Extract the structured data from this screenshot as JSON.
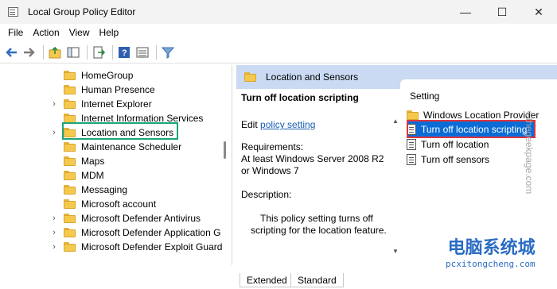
{
  "window": {
    "title": "Local Group Policy Editor",
    "min_glyph": "—",
    "max_glyph": "☐",
    "close_glyph": "✕"
  },
  "menu": [
    "File",
    "Action",
    "View",
    "Help"
  ],
  "toolbar": {
    "icons": [
      "back-arrow-icon",
      "forward-arrow-icon",
      "up-folder-icon",
      "show-hide-tree-icon",
      "export-list-icon",
      "help-icon",
      "view-icon",
      "filter-icon"
    ]
  },
  "tree": {
    "items": [
      {
        "label": "HomeGroup",
        "expandable": false
      },
      {
        "label": "Human Presence",
        "expandable": false
      },
      {
        "label": "Internet Explorer",
        "expandable": true
      },
      {
        "label": "Internet Information Services",
        "expandable": false
      },
      {
        "label": "Location and Sensors",
        "expandable": true,
        "highlighted": true
      },
      {
        "label": "Maintenance Scheduler",
        "expandable": false
      },
      {
        "label": "Maps",
        "expandable": false
      },
      {
        "label": "MDM",
        "expandable": false
      },
      {
        "label": "Messaging",
        "expandable": false
      },
      {
        "label": "Microsoft account",
        "expandable": false
      },
      {
        "label": "Microsoft Defender Antivirus",
        "expandable": true
      },
      {
        "label": "Microsoft Defender Application G",
        "expandable": true
      },
      {
        "label": "Microsoft Defender Exploit Guard",
        "expandable": true
      }
    ]
  },
  "details": {
    "header": "Location and Sensors",
    "policy_title": "Turn off location scripting",
    "edit_prefix": "Edit",
    "edit_link": "policy setting",
    "requirements_label": "Requirements:",
    "requirements_line1": "At least Windows Server 2008 R2",
    "requirements_line2": "or Windows 7",
    "description_label": "Description:",
    "description_line1": "This policy setting turns off",
    "description_line2": "scripting for the location feature."
  },
  "settings": {
    "header": "Setting",
    "items": [
      {
        "label": "Windows Location Provider",
        "type": "folder"
      },
      {
        "label": "Turn off location scripting",
        "type": "policy",
        "selected": true
      },
      {
        "label": "Turn off location",
        "type": "policy"
      },
      {
        "label": "Turn off sensors",
        "type": "policy"
      }
    ]
  },
  "tabs": [
    "Extended",
    "Standard"
  ],
  "watermark": {
    "vertical": "©thegeekpage.com",
    "cn": "电脑系统城",
    "en": "pcxitongcheng.com"
  },
  "colors": {
    "selection": "#0a6cd6",
    "header_bg": "#c9daf2",
    "tree_highlight": "#1ba57a",
    "selection_box": "#e0353b",
    "link": "#1a5fb4"
  }
}
